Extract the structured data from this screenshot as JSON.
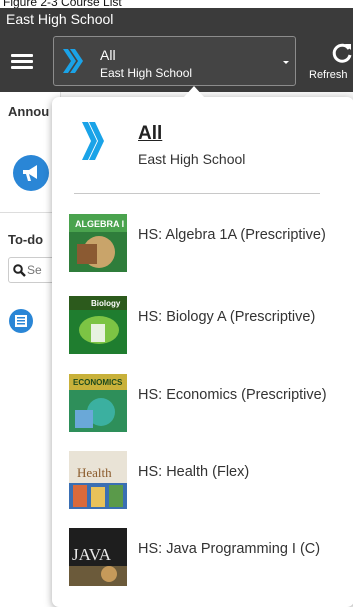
{
  "caption": "Figure 2-3 Course List",
  "school_bar": {
    "name": "East High School"
  },
  "navbar": {
    "selector": {
      "title": "All",
      "subtitle": "East High School"
    },
    "refresh_label": "Refresh"
  },
  "panel": {
    "announcements_label": "Annou",
    "todo_label": "To-do",
    "search_placeholder": "Se"
  },
  "dropdown": {
    "all": {
      "title": "All",
      "subtitle": "East High School"
    },
    "courses": [
      {
        "name": "HS: Algebra 1A (Prescriptive)",
        "cover_text": "ALGEBRA I"
      },
      {
        "name": "HS: Biology A (Prescriptive)",
        "cover_text": "Biology"
      },
      {
        "name": "HS: Economics (Prescriptive)",
        "cover_text": "ECONOMICS"
      },
      {
        "name": "HS: Health (Flex)",
        "cover_text": "Health"
      },
      {
        "name": "HS: Java Programming I (C)",
        "cover_text": "JAVA"
      }
    ]
  },
  "colors": {
    "navbar": "#3b3b3b",
    "brand_blue": "#2a86d6",
    "logo_blue": "#1aa3e8"
  },
  "icons": {
    "menu": "hamburger-icon",
    "brand": "chevron-logo-icon",
    "refresh": "refresh-icon",
    "announcement": "megaphone-icon",
    "search": "search-icon",
    "task": "list-icon"
  }
}
